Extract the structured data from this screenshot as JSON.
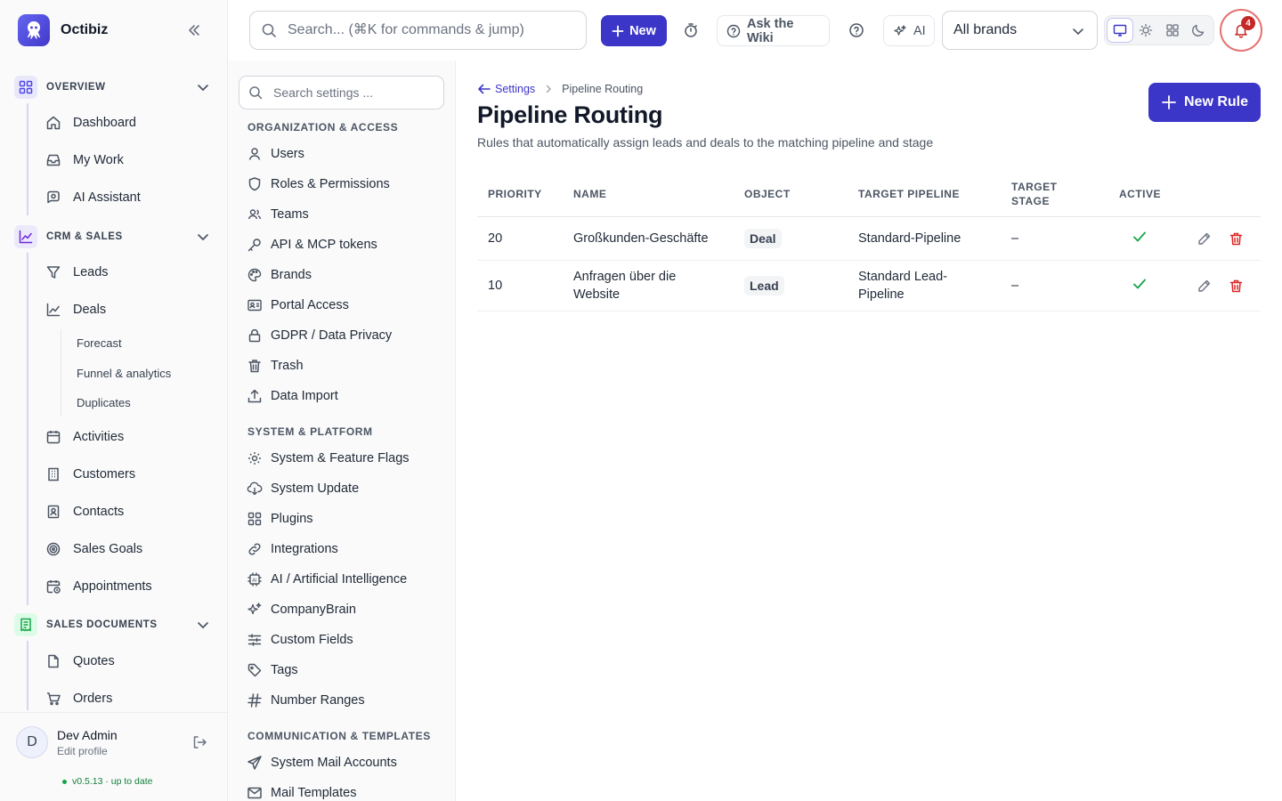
{
  "app": {
    "name": "Octibiz"
  },
  "topbar": {
    "search_placeholder": "Search... (⌘K for commands & jump)",
    "new_label": "New",
    "wiki_label": "Ask the Wiki",
    "ai_label": "AI",
    "brand_select": "All brands",
    "notifications_count": "4",
    "accent": "#3b35c8"
  },
  "sidebar": {
    "groups": [
      {
        "label": "OVERVIEW",
        "items": [
          "Dashboard",
          "My Work",
          "AI Assistant"
        ]
      },
      {
        "label": "CRM & SALES",
        "items": [
          "Leads",
          "Deals",
          "Activities",
          "Customers",
          "Contacts",
          "Sales Goals",
          "Appointments"
        ],
        "subitems": [
          "Forecast",
          "Funnel & analytics",
          "Duplicates"
        ]
      },
      {
        "label": "SALES DOCUMENTS",
        "items": [
          "Quotes",
          "Orders"
        ]
      }
    ],
    "user": {
      "initial": "D",
      "name": "Dev Admin",
      "edit": "Edit profile",
      "version": "v0.5.13 · up to date"
    }
  },
  "settings_nav": {
    "search_placeholder": "Search settings ...",
    "sections": [
      {
        "label": "ORGANIZATION & ACCESS",
        "items": [
          "Users",
          "Roles & Permissions",
          "Teams",
          "API & MCP tokens",
          "Brands",
          "Portal Access",
          "GDPR / Data Privacy",
          "Trash",
          "Data Import"
        ]
      },
      {
        "label": "SYSTEM & PLATFORM",
        "items": [
          "System & Feature Flags",
          "System Update",
          "Plugins",
          "Integrations",
          "AI / Artificial Intelligence",
          "CompanyBrain",
          "Custom Fields",
          "Tags",
          "Number Ranges"
        ]
      },
      {
        "label": "COMMUNICATION & TEMPLATES",
        "items": [
          "System Mail Accounts",
          "Mail Templates"
        ]
      }
    ]
  },
  "page": {
    "breadcrumb_back": "Settings",
    "breadcrumb_current": "Pipeline Routing",
    "title": "Pipeline Routing",
    "description": "Rules that automatically assign leads and deals to the matching pipeline and stage",
    "new_rule_label": "New Rule",
    "columns": [
      "PRIORITY",
      "NAME",
      "OBJECT",
      "TARGET PIPELINE",
      "TARGET STAGE",
      "ACTIVE"
    ],
    "rows": [
      {
        "priority": "20",
        "name": "Großkunden-Geschäfte",
        "object": "Deal",
        "pipeline": "Standard-Pipeline",
        "stage": "–",
        "active": true
      },
      {
        "priority": "10",
        "name": "Anfragen über die Website",
        "object": "Lead",
        "pipeline": "Standard Lead-Pipeline",
        "stage": "–",
        "active": true
      }
    ]
  }
}
